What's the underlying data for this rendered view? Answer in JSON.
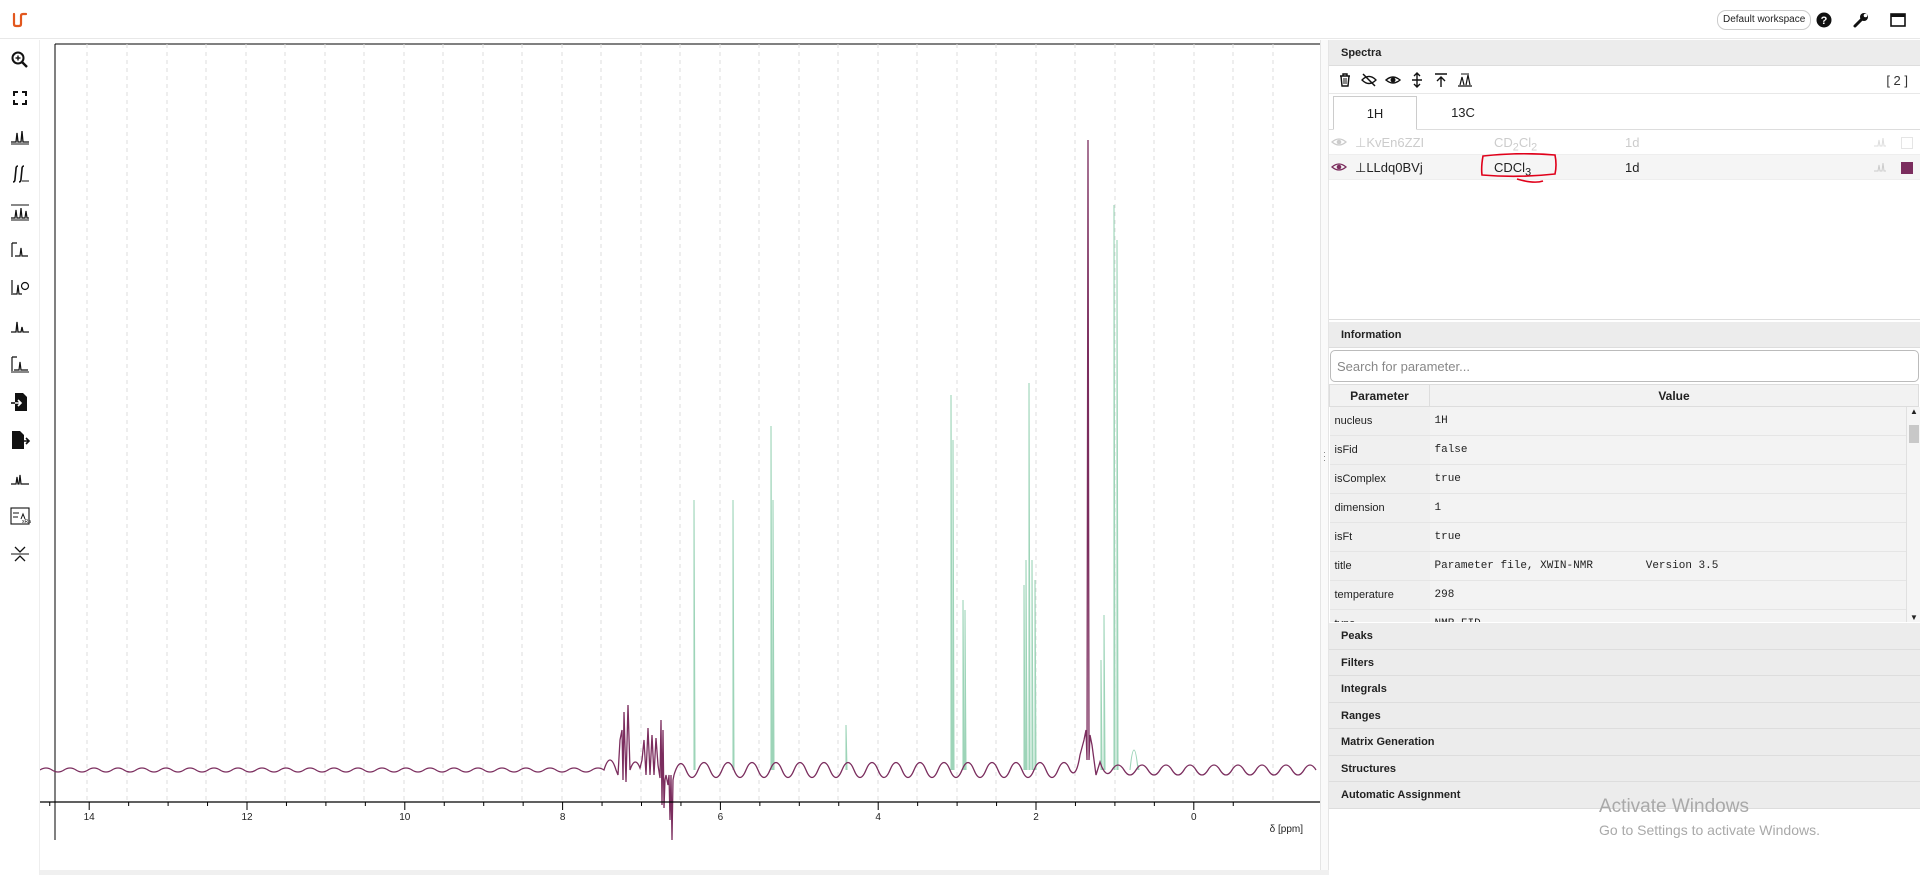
{
  "header": {
    "workspace_label": "Default workspace",
    "icons": [
      "help-icon",
      "wrench-icon",
      "window-icon"
    ]
  },
  "toolbar_left": {
    "tools": [
      "zoom-icon",
      "full-spectrum-icon",
      "peak-picking-icon",
      "integral-icon",
      "ranges-icon",
      "phase-correction-icon",
      "baseline-correction-icon",
      "spectrum-icon",
      "exclusion-zone-icon",
      "import-icon",
      "export-icon",
      "multiplet-icon",
      "manual-zones-icon",
      "symmetrize-icon"
    ]
  },
  "plot": {
    "x_axis_label": "δ [ppm]",
    "x_ticks": [
      "14",
      "12",
      "10",
      "8",
      "6",
      "4",
      "2",
      "0"
    ]
  },
  "panel": {
    "spectra_title": "Spectra",
    "spectra_count": "[ 2 ]",
    "tabs": [
      "1H",
      "13C"
    ],
    "spectra": [
      {
        "name": "KvEn6ZZI",
        "solvent": "CD2Cl2",
        "solvent_base": "CD",
        "solvent_sub1": "2",
        "solvent_mid": "Cl",
        "solvent_sub2": "2",
        "dimension": "1d",
        "visible": false
      },
      {
        "name": "LLdq0BVj",
        "solvent": "CDCl3",
        "solvent_base": "CDCl",
        "solvent_sub1": "3",
        "dimension": "1d",
        "visible": true,
        "color": "#7b2d5e"
      }
    ],
    "information_title": "Information",
    "search_placeholder": "Search for parameter...",
    "table_headers": {
      "param": "Parameter",
      "value": "Value"
    },
    "parameters": [
      {
        "param": "nucleus",
        "value": "1H"
      },
      {
        "param": "isFid",
        "value": "false"
      },
      {
        "param": "isComplex",
        "value": "true"
      },
      {
        "param": "dimension",
        "value": "1"
      },
      {
        "param": "isFt",
        "value": "true"
      },
      {
        "param": "title",
        "value": "Parameter file, XWIN-NMR        Version 3.5"
      },
      {
        "param": "temperature",
        "value": "298"
      },
      {
        "param": "type",
        "value": "NMR FID"
      }
    ],
    "accordion": [
      "Peaks",
      "Filters",
      "Integrals",
      "Ranges",
      "Matrix Generation",
      "Structures",
      "Automatic Assignment"
    ]
  },
  "watermark": {
    "line1": "Activate Windows",
    "line2": "Go to Settings to activate Windows."
  }
}
